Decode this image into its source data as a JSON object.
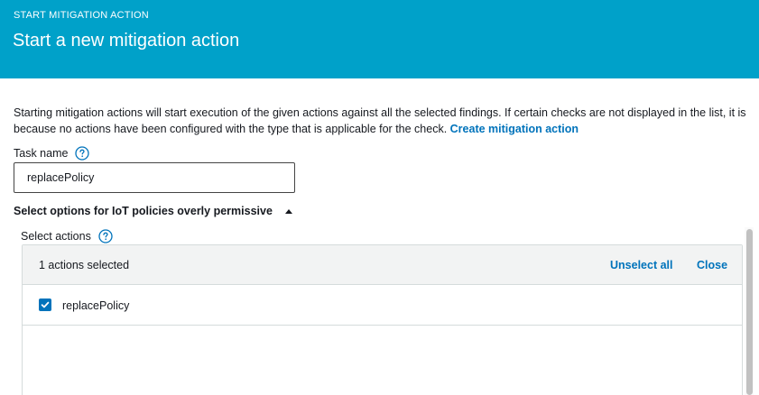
{
  "header": {
    "eyebrow": "START MITIGATION ACTION",
    "title": "Start a new mitigation action"
  },
  "description": {
    "text": "Starting mitigation actions will start execution of the given actions against all the selected findings. If certain checks are not displayed in the list, it is because no actions have been configured with the type that is applicable for the check.",
    "link": "Create mitigation action"
  },
  "task_name": {
    "label": "Task name",
    "value": "replacePolicy"
  },
  "section": {
    "title": "Select options for IoT policies overly permissive",
    "expanded": true
  },
  "select_actions": {
    "label": "Select actions",
    "summary": "1 actions selected",
    "unselect_all": "Unselect all",
    "close": "Close",
    "options": [
      {
        "label": "replacePolicy",
        "checked": true
      }
    ]
  },
  "icons": [
    "help-icon",
    "caret-up-icon",
    "checkmark-icon"
  ],
  "colors": {
    "header_bg": "#00a1c9",
    "link": "#0073bb",
    "panel_head_bg": "#f2f3f3",
    "border": "#d5dbdb"
  }
}
